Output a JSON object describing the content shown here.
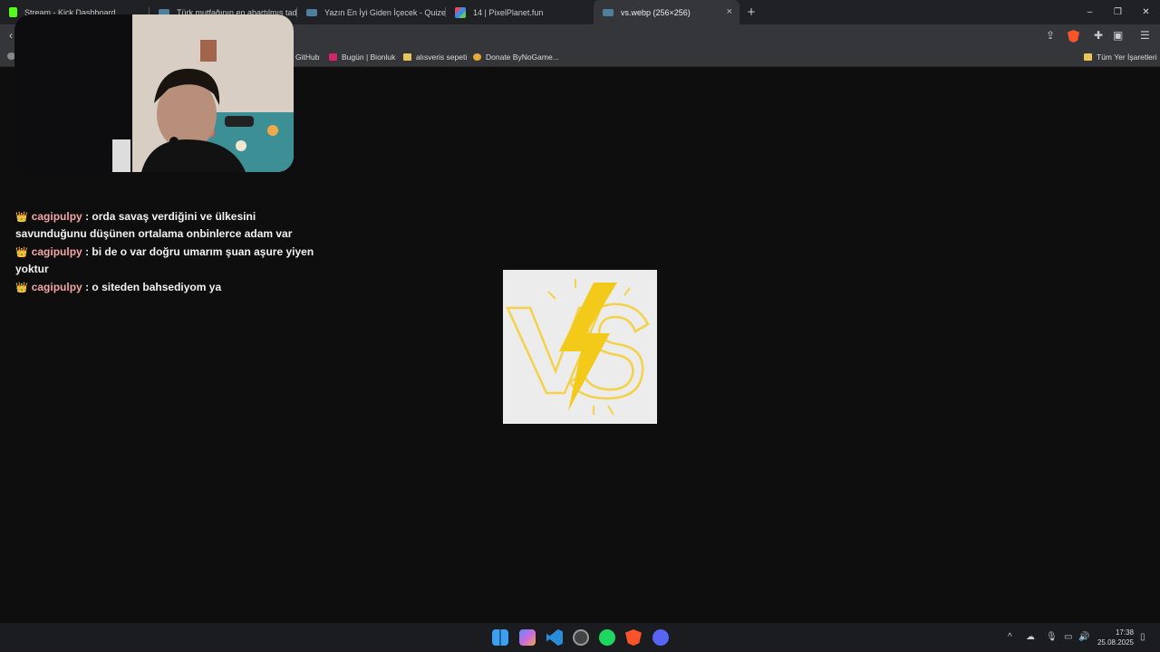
{
  "browser": {
    "tabs": [
      {
        "title": "Stream - Kick Dashboard",
        "active": false
      },
      {
        "title": "Türk mutfağının en abartılmış tadını",
        "active": false
      },
      {
        "title": "Yazın En İyi Giden İçecek - Quizei",
        "active": false
      },
      {
        "title": "14 | PixelPlanet.fun",
        "active": false
      },
      {
        "title": "vs.webp (256×256)",
        "active": true
      }
    ],
    "new_tab": "+",
    "tab_close": "×",
    "window": {
      "minimize": "–",
      "maximize": "❐",
      "close": "✕"
    }
  },
  "bookmarks": {
    "left": [
      {
        "label": "GitHub"
      },
      {
        "label": "Bugün | Bionluk"
      },
      {
        "label": "alısveris sepeti"
      },
      {
        "label": "Donate ByNoGame..."
      }
    ],
    "right": {
      "label": "Tüm Yer İşaretleri"
    }
  },
  "chat": {
    "messages": [
      {
        "user": "cagipulpy",
        "text": "orda savaş verdiğini ve ülkesini savunduğunu düşünen ortalama onbinlerce adam var"
      },
      {
        "user": "cagipulpy",
        "text": "bi de o var doğru umarım şuan aşure yiyen yoktur"
      },
      {
        "user": "cagipulpy",
        "text": "o siteden bahsediyom ya"
      }
    ],
    "separator": ":"
  },
  "image": {
    "alt_word": "VS"
  },
  "taskbar": {
    "clock_time": "17:38",
    "clock_date": "25.08.2025"
  },
  "colors": {
    "bolt": "#f3c91a",
    "username": "#f2a5a5",
    "kick_green": "#53fc18"
  }
}
